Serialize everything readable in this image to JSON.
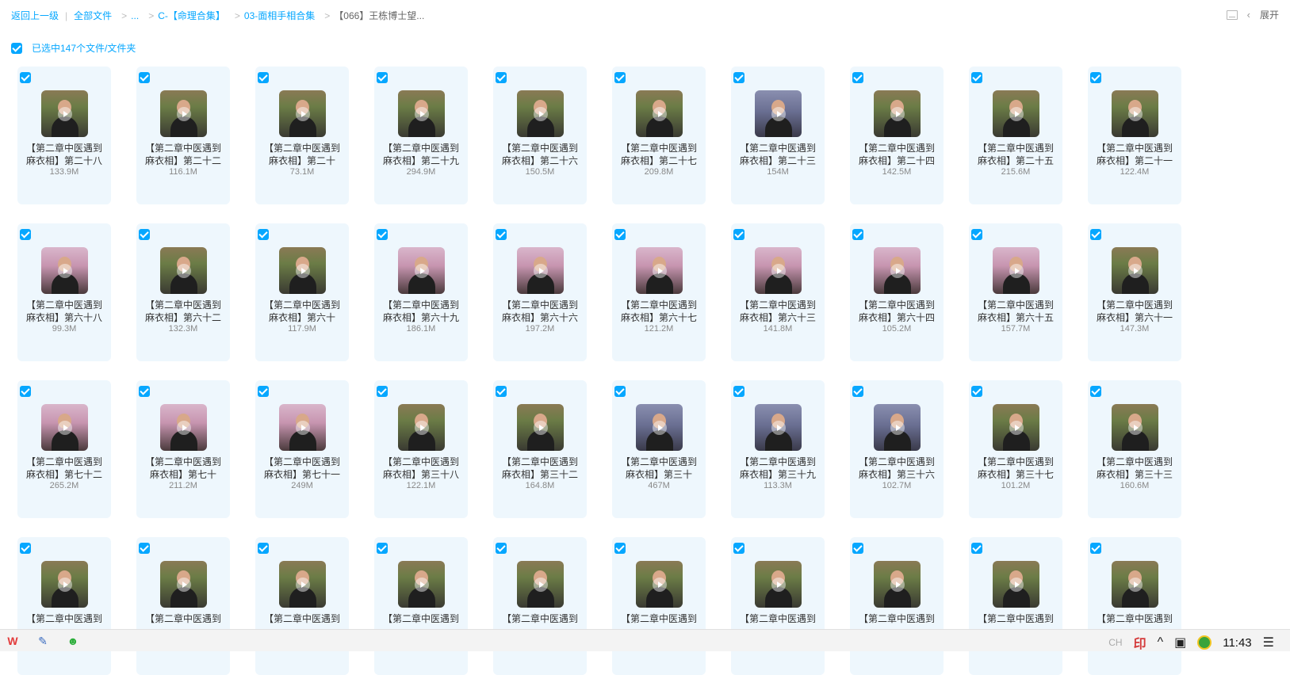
{
  "breadcrumb": {
    "back": "返回上一级",
    "sep": "|",
    "all": "全部文件",
    "items": [
      ">",
      "...",
      ">",
      "C-【命理合集】",
      ">",
      "03-面相手相合集",
      ">"
    ],
    "current": "【066】王栋博士望..."
  },
  "top_right": {
    "list_icon": "list-view-icon",
    "collapse_icon": "chevron-left-icon",
    "expand_label": "展开"
  },
  "selection": {
    "label": "已选中147个文件/文件夹"
  },
  "files": [
    {
      "l1": "【第二章中医遇到",
      "l2": "麻衣相】第二十八",
      "size": "133.9M",
      "tone": ""
    },
    {
      "l1": "【第二章中医遇到",
      "l2": "麻衣相】第二十二",
      "size": "116.1M",
      "tone": ""
    },
    {
      "l1": "【第二章中医遇到",
      "l2": "麻衣相】第二十",
      "size": "73.1M",
      "tone": ""
    },
    {
      "l1": "【第二章中医遇到",
      "l2": "麻衣相】第二十九",
      "size": "294.9M",
      "tone": ""
    },
    {
      "l1": "【第二章中医遇到",
      "l2": "麻衣相】第二十六",
      "size": "150.5M",
      "tone": ""
    },
    {
      "l1": "【第二章中医遇到",
      "l2": "麻衣相】第二十七",
      "size": "209.8M",
      "tone": ""
    },
    {
      "l1": "【第二章中医遇到",
      "l2": "麻衣相】第二十三",
      "size": "154M",
      "tone": "blue"
    },
    {
      "l1": "【第二章中医遇到",
      "l2": "麻衣相】第二十四",
      "size": "142.5M",
      "tone": ""
    },
    {
      "l1": "【第二章中医遇到",
      "l2": "麻衣相】第二十五",
      "size": "215.6M",
      "tone": ""
    },
    {
      "l1": "【第二章中医遇到",
      "l2": "麻衣相】第二十一",
      "size": "122.4M",
      "tone": ""
    },
    {
      "l1": "【第二章中医遇到",
      "l2": "麻衣相】第六十八",
      "size": "99.3M",
      "tone": "pink"
    },
    {
      "l1": "【第二章中医遇到",
      "l2": "麻衣相】第六十二",
      "size": "132.3M",
      "tone": ""
    },
    {
      "l1": "【第二章中医遇到",
      "l2": "麻衣相】第六十",
      "size": "117.9M",
      "tone": ""
    },
    {
      "l1": "【第二章中医遇到",
      "l2": "麻衣相】第六十九",
      "size": "186.1M",
      "tone": "pink"
    },
    {
      "l1": "【第二章中医遇到",
      "l2": "麻衣相】第六十六",
      "size": "197.2M",
      "tone": "pink"
    },
    {
      "l1": "【第二章中医遇到",
      "l2": "麻衣相】第六十七",
      "size": "121.2M",
      "tone": "pink"
    },
    {
      "l1": "【第二章中医遇到",
      "l2": "麻衣相】第六十三",
      "size": "141.8M",
      "tone": "pink"
    },
    {
      "l1": "【第二章中医遇到",
      "l2": "麻衣相】第六十四",
      "size": "105.2M",
      "tone": "pink"
    },
    {
      "l1": "【第二章中医遇到",
      "l2": "麻衣相】第六十五",
      "size": "157.7M",
      "tone": "pink"
    },
    {
      "l1": "【第二章中医遇到",
      "l2": "麻衣相】第六十一",
      "size": "147.3M",
      "tone": ""
    },
    {
      "l1": "【第二章中医遇到",
      "l2": "麻衣相】第七十二",
      "size": "265.2M",
      "tone": "pink"
    },
    {
      "l1": "【第二章中医遇到",
      "l2": "麻衣相】第七十",
      "size": "211.2M",
      "tone": "pink"
    },
    {
      "l1": "【第二章中医遇到",
      "l2": "麻衣相】第七十一",
      "size": "249M",
      "tone": "pink"
    },
    {
      "l1": "【第二章中医遇到",
      "l2": "麻衣相】第三十八",
      "size": "122.1M",
      "tone": ""
    },
    {
      "l1": "【第二章中医遇到",
      "l2": "麻衣相】第三十二",
      "size": "164.8M",
      "tone": ""
    },
    {
      "l1": "【第二章中医遇到",
      "l2": "麻衣相】第三十",
      "size": "467M",
      "tone": "blue"
    },
    {
      "l1": "【第二章中医遇到",
      "l2": "麻衣相】第三十九",
      "size": "113.3M",
      "tone": "blue"
    },
    {
      "l1": "【第二章中医遇到",
      "l2": "麻衣相】第三十六",
      "size": "102.7M",
      "tone": "blue"
    },
    {
      "l1": "【第二章中医遇到",
      "l2": "麻衣相】第三十七",
      "size": "101.2M",
      "tone": ""
    },
    {
      "l1": "【第二章中医遇到",
      "l2": "麻衣相】第三十三",
      "size": "160.6M",
      "tone": ""
    },
    {
      "l1": "【第二章中医遇到",
      "l2": "",
      "size": "",
      "tone": ""
    },
    {
      "l1": "【第二章中医遇到",
      "l2": "",
      "size": "",
      "tone": ""
    },
    {
      "l1": "【第二章中医遇到",
      "l2": "",
      "size": "",
      "tone": ""
    },
    {
      "l1": "【第二章中医遇到",
      "l2": "",
      "size": "",
      "tone": ""
    },
    {
      "l1": "【第二章中医遇到",
      "l2": "",
      "size": "",
      "tone": ""
    },
    {
      "l1": "【第二章中医遇到",
      "l2": "",
      "size": "",
      "tone": ""
    },
    {
      "l1": "【第二章中医遇到",
      "l2": "",
      "size": "",
      "tone": ""
    },
    {
      "l1": "【第二章中医遇到",
      "l2": "",
      "size": "",
      "tone": ""
    },
    {
      "l1": "【第二章中医遇到",
      "l2": "",
      "size": "",
      "tone": ""
    },
    {
      "l1": "【第二章中医遇到",
      "l2": "",
      "size": "",
      "tone": ""
    }
  ],
  "taskbar": {
    "apps": [
      {
        "name": "wps-icon",
        "glyph": "W"
      },
      {
        "name": "notepad-icon",
        "glyph": "✎"
      },
      {
        "name": "wechat-icon",
        "glyph": "☻"
      }
    ],
    "lang": "CH",
    "tray_up": "^",
    "clock": "11:43",
    "notification_glyph": "☰"
  },
  "colors": {
    "accent": "#06a7ff",
    "card_bg": "#eef7fd"
  }
}
